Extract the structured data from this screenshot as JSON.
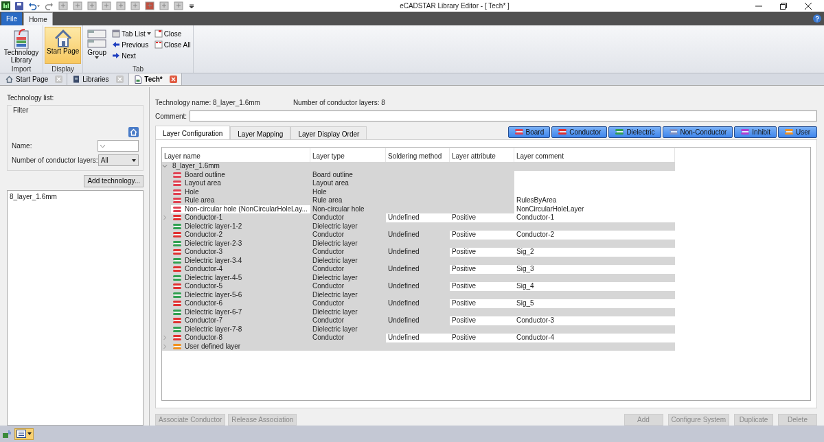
{
  "window": {
    "title": "eCADSTAR Library Editor - [ Tech* ]"
  },
  "ribbon_tabs": [
    {
      "label": "File",
      "selected": false,
      "kind": "file"
    },
    {
      "label": "Home",
      "selected": true,
      "kind": "tab"
    }
  ],
  "ribbon_groups": [
    {
      "label": "Import",
      "items": [
        {
          "label": "Technology Library",
          "kind": "import",
          "selected": false
        }
      ]
    },
    {
      "label": "Display",
      "items": [
        {
          "label": "Start Page",
          "kind": "home",
          "selected": true
        }
      ]
    },
    {
      "label": "Tab",
      "items": [
        {
          "label": "Group",
          "kind": "group",
          "selected": false
        },
        {
          "label": "Tab List",
          "kind": "tab-list",
          "selected": false
        },
        {
          "label": "Previous",
          "kind": "previous",
          "selected": false
        },
        {
          "label": "Next",
          "kind": "next",
          "selected": false
        },
        {
          "label": "Close",
          "kind": "close",
          "selected": false
        },
        {
          "label": "Close All",
          "kind": "close-all",
          "selected": false
        }
      ]
    }
  ],
  "doc_tabs": [
    {
      "label": "Start Page",
      "kind": "home",
      "selected": false
    },
    {
      "label": "Libraries",
      "kind": "book",
      "selected": false
    },
    {
      "label": "Tech*",
      "kind": "doc",
      "selected": true
    }
  ],
  "left_panel": {
    "heading": "Technology list:",
    "filter": {
      "legend": "Filter",
      "name_label": "Name:",
      "layers_label": "Number of conductor layers:",
      "layers_value": "All"
    },
    "add_button": "Add technology...",
    "items": [
      {
        "label": "8_layer_1.6mm",
        "selected": false
      }
    ]
  },
  "technology": {
    "name_text": "Technology name: 8_layer_1.6mm",
    "count_text": "Number of conductor layers: 8",
    "comment_label": "Comment:"
  },
  "tabs": [
    {
      "label": "Layer Configuration",
      "selected": true
    },
    {
      "label": "Layer Mapping",
      "selected": false
    },
    {
      "label": "Layer Display Order",
      "selected": false
    }
  ],
  "layer_filters": [
    {
      "label": "Board",
      "kind": "board",
      "on": true
    },
    {
      "label": "Conductor",
      "kind": "conductor",
      "on": true
    },
    {
      "label": "Dielectric",
      "kind": "dielectric",
      "on": true
    },
    {
      "label": "Non-Conductor",
      "kind": "non-conductor",
      "on": true
    },
    {
      "label": "Inhibit",
      "kind": "inhibit",
      "on": true
    },
    {
      "label": "User",
      "kind": "user",
      "on": true
    }
  ],
  "table": {
    "columns": [
      "Layer name",
      "Layer type",
      "Soldering method",
      "Layer attribute",
      "Layer comment"
    ],
    "tree": [
      {
        "name": "8_layer_1.6mm",
        "expanded": true,
        "children": [
          {
            "name": "Board outline",
            "kind": "board",
            "type": "Board outline",
            "selected": false
          },
          {
            "name": "Layout area",
            "kind": "board",
            "type": "Layout area",
            "selected": false
          },
          {
            "name": "Hole",
            "kind": "board",
            "type": "Hole",
            "selected": false
          },
          {
            "name": "Rule area",
            "kind": "board",
            "type": "Rule area",
            "comment": "RulesByArea",
            "selected": false
          },
          {
            "name": "Non-circular hole (NonCircularHoleLay...",
            "kind": "board",
            "type": "Non-circular hole",
            "comment": "NonCircularHoleLayer",
            "selected": true
          },
          {
            "name": "Conductor-1",
            "kind": "conductor",
            "type": "Conductor",
            "soldering": "Undefined",
            "attribute": "Positive",
            "comment": "Conductor-1",
            "expanded": false,
            "selected": false
          },
          {
            "name": "Dielectric layer-1-2",
            "kind": "dielectric",
            "type": "Dielectric layer",
            "selected": false
          },
          {
            "name": "Conductor-2",
            "kind": "conductor",
            "type": "Conductor",
            "soldering": "Undefined",
            "attribute": "Positive",
            "comment": "Conductor-2",
            "selected": false
          },
          {
            "name": "Dielectric layer-2-3",
            "kind": "dielectric",
            "type": "Dielectric layer",
            "selected": false
          },
          {
            "name": "Conductor-3",
            "kind": "conductor",
            "type": "Conductor",
            "soldering": "Undefined",
            "attribute": "Positive",
            "comment": "Sig_2",
            "selected": false
          },
          {
            "name": "Dielectric layer-3-4",
            "kind": "dielectric",
            "type": "Dielectric layer",
            "selected": false
          },
          {
            "name": "Conductor-4",
            "kind": "conductor",
            "type": "Conductor",
            "soldering": "Undefined",
            "attribute": "Positive",
            "comment": "Sig_3",
            "selected": false
          },
          {
            "name": "Dielectric layer-4-5",
            "kind": "dielectric",
            "type": "Dielectric layer",
            "selected": false
          },
          {
            "name": "Conductor-5",
            "kind": "conductor",
            "type": "Conductor",
            "soldering": "Undefined",
            "attribute": "Positive",
            "comment": "Sig_4",
            "selected": false
          },
          {
            "name": "Dielectric layer-5-6",
            "kind": "dielectric",
            "type": "Dielectric layer",
            "selected": false
          },
          {
            "name": "Conductor-6",
            "kind": "conductor",
            "type": "Conductor",
            "soldering": "Undefined",
            "attribute": "Positive",
            "comment": "Sig_5",
            "selected": false
          },
          {
            "name": "Dielectric layer-6-7",
            "kind": "dielectric",
            "type": "Dielectric layer",
            "selected": false
          },
          {
            "name": "Conductor-7",
            "kind": "conductor",
            "type": "Conductor",
            "soldering": "Undefined",
            "attribute": "Positive",
            "comment": "Conductor-3",
            "selected": false
          },
          {
            "name": "Dielectric layer-7-8",
            "kind": "dielectric",
            "type": "Dielectric layer",
            "selected": false
          },
          {
            "name": "Conductor-8",
            "kind": "conductor",
            "type": "Conductor",
            "soldering": "Undefined",
            "attribute": "Positive",
            "comment": "Conductor-4",
            "expanded": false,
            "selected": false
          },
          {
            "name": "User defined layer",
            "kind": "user",
            "expanded": false,
            "selected": false
          }
        ]
      }
    ]
  },
  "left_buttons": [
    {
      "label": "Associate Conductor",
      "disabled": true
    },
    {
      "label": "Release Association",
      "disabled": true
    }
  ],
  "right_buttons": [
    {
      "label": "Add",
      "disabled": true
    },
    {
      "label": "Configure System",
      "disabled": true
    },
    {
      "label": "Duplicate",
      "disabled": true
    },
    {
      "label": "Delete",
      "disabled": true
    }
  ]
}
